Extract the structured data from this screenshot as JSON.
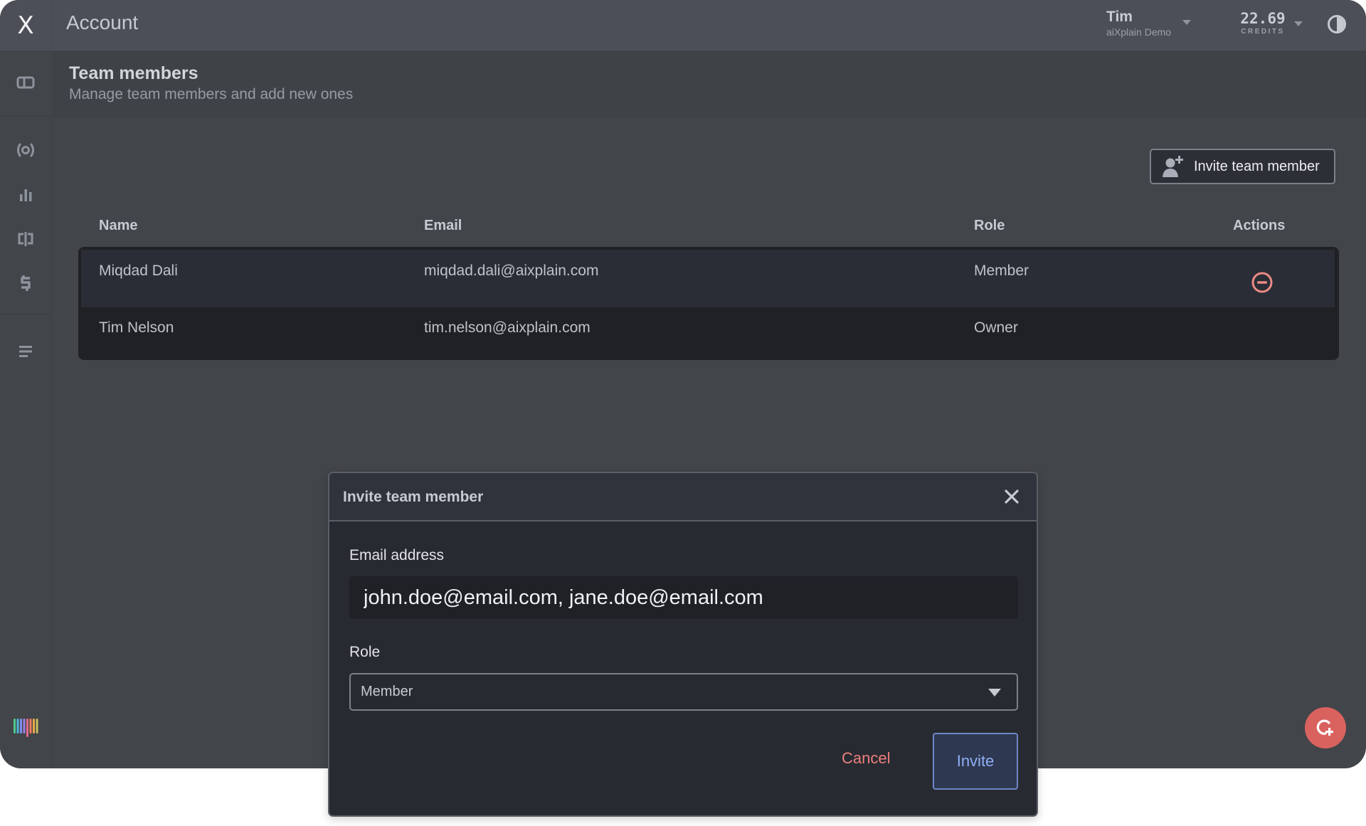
{
  "header": {
    "logo": "X",
    "title": "Account",
    "user": {
      "name": "Tim",
      "org": "aiXplain Demo"
    },
    "credits": {
      "value": "22.69",
      "label": "CREDITS"
    },
    "theme_toggle_icon": "half-circle-contrast-icon"
  },
  "sidebar": {
    "items": [
      {
        "icon": "dashboard-panel-icon"
      },
      {
        "icon": "broadcast-icon"
      },
      {
        "icon": "bar-chart-icon"
      },
      {
        "icon": "split-view-icon"
      },
      {
        "icon": "dollar-icon"
      },
      {
        "icon": "menu-lines-icon"
      }
    ],
    "bottom_icon": "rainbow-chat-logo-icon"
  },
  "page": {
    "title": "Team members",
    "subtitle": "Manage team members and add new ones",
    "invite_button_label": "Invite team member"
  },
  "table": {
    "columns": [
      "Name",
      "Email",
      "Role",
      "Actions"
    ],
    "rows": [
      {
        "name": "Miqdad Dali",
        "email": "miqdad.dali@aixplain.com",
        "role": "Member",
        "action_icon": "remove-circle-icon"
      },
      {
        "name": "Tim Nelson",
        "email": "tim.nelson@aixplain.com",
        "role": "Owner"
      }
    ]
  },
  "dialog": {
    "title": "Invite team member",
    "email_label": "Email address",
    "email_value": "john.doe@email.com, jane.doe@email.com",
    "role_label": "Role",
    "role_value": "Member",
    "cancel_label": "Cancel",
    "invite_label": "Invite"
  },
  "colors": {
    "danger": "#ec7f7c",
    "primary": "#8fb0f6",
    "fab": "#d9625f"
  }
}
